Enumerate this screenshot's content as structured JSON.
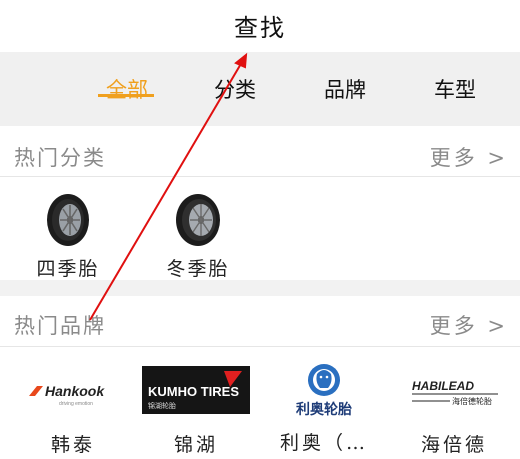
{
  "header": {
    "title": "查找"
  },
  "tabs": [
    {
      "label": "全部",
      "active": true
    },
    {
      "label": "分类",
      "active": false
    },
    {
      "label": "品牌",
      "active": false
    },
    {
      "label": "车型",
      "active": false
    }
  ],
  "accent_color": "#f0a01e",
  "hot_categories": {
    "title": "热门分类",
    "more": "更多 >",
    "items": [
      {
        "label": "四季胎",
        "icon": "tire-icon"
      },
      {
        "label": "冬季胎",
        "icon": "tire-icon"
      }
    ]
  },
  "hot_brands": {
    "title": "热门品牌",
    "more": "更多 >",
    "items": [
      {
        "label": "韩泰",
        "logo_text": "Hankook",
        "logo_sub": "driving emotion"
      },
      {
        "label": "锦湖",
        "logo_text": "KUMHO TIRES",
        "logo_sub": "锦湖轮胎"
      },
      {
        "label": "利奥（…",
        "logo_text": "利奥轮胎"
      },
      {
        "label": "海倍德",
        "logo_text": "HABILEAD",
        "logo_sub": "海倍德轮胎"
      }
    ]
  }
}
